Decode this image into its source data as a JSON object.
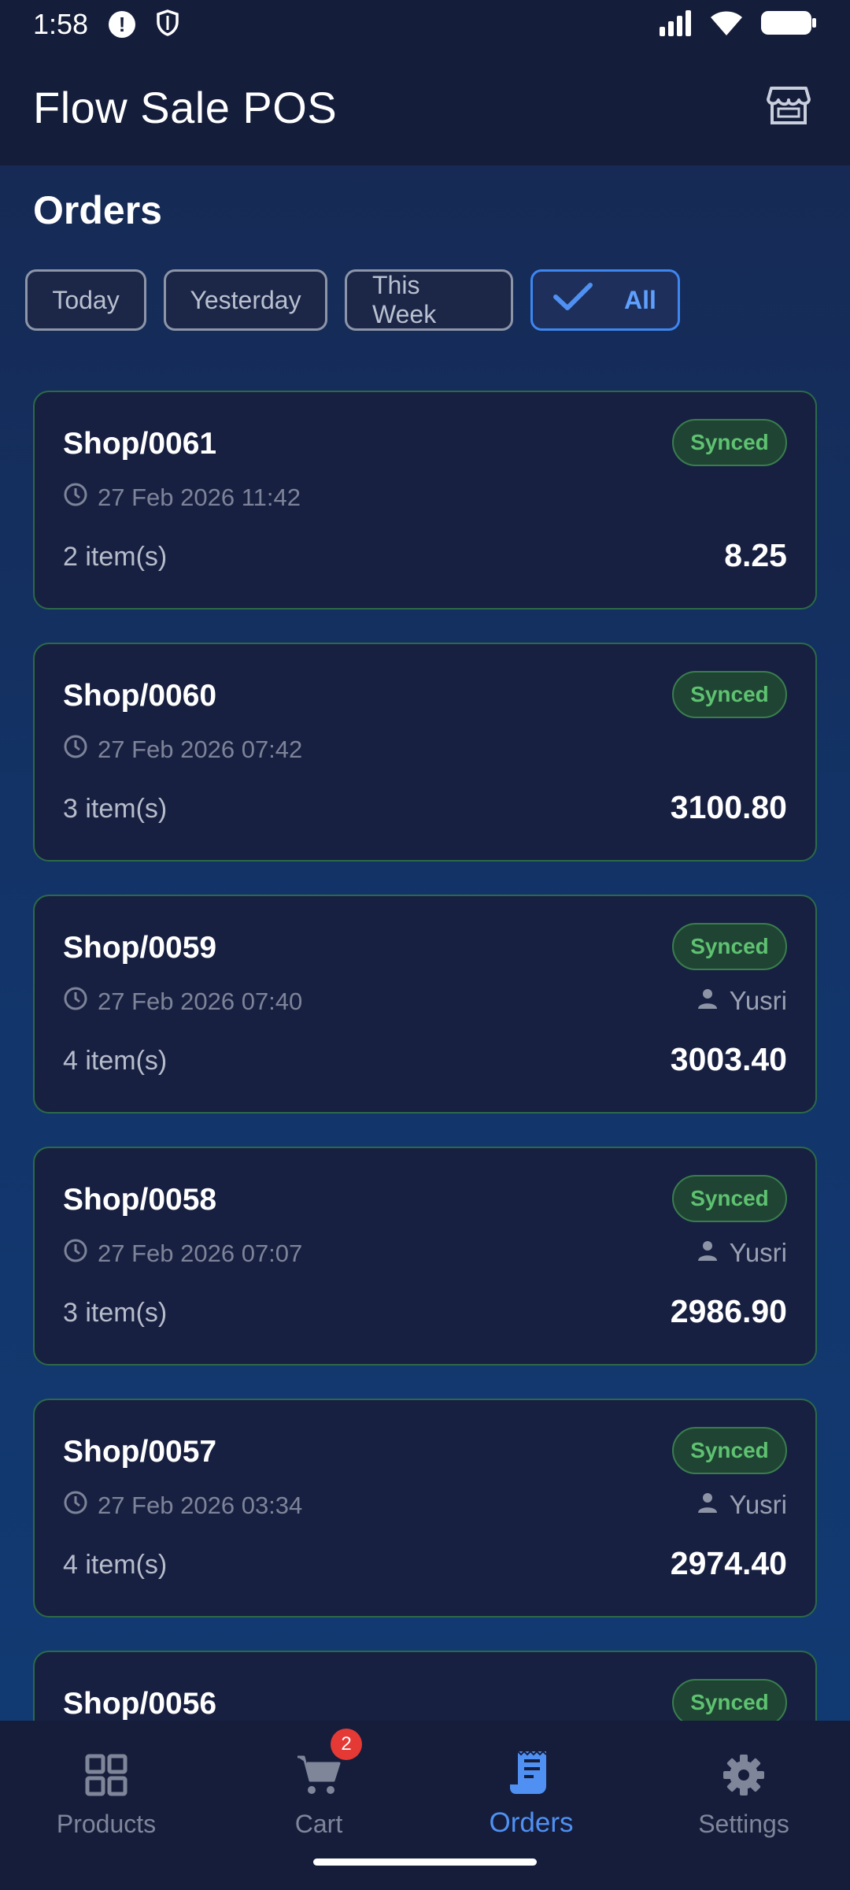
{
  "status_bar": {
    "time": "1:58"
  },
  "app_bar": {
    "title": "Flow Sale POS",
    "icon": "store-icon"
  },
  "page": {
    "title": "Orders"
  },
  "filters": [
    {
      "label": "Today",
      "selected": false
    },
    {
      "label": "Yesterday",
      "selected": false
    },
    {
      "label": "This Week",
      "selected": false
    },
    {
      "label": "All",
      "selected": true
    }
  ],
  "orders": [
    {
      "id": "Shop/0061",
      "status": "Synced",
      "date": "27 Feb 2026 11:42",
      "user": "",
      "items": "2 item(s)",
      "total": "8.25"
    },
    {
      "id": "Shop/0060",
      "status": "Synced",
      "date": "27 Feb 2026 07:42",
      "user": "",
      "items": "3 item(s)",
      "total": "3100.80"
    },
    {
      "id": "Shop/0059",
      "status": "Synced",
      "date": "27 Feb 2026 07:40",
      "user": "Yusri",
      "items": "4 item(s)",
      "total": "3003.40"
    },
    {
      "id": "Shop/0058",
      "status": "Synced",
      "date": "27 Feb 2026 07:07",
      "user": "Yusri",
      "items": "3 item(s)",
      "total": "2986.90"
    },
    {
      "id": "Shop/0057",
      "status": "Synced",
      "date": "27 Feb 2026 03:34",
      "user": "Yusri",
      "items": "4 item(s)",
      "total": "2974.40"
    },
    {
      "id": "Shop/0056",
      "status": "Synced",
      "date": "",
      "user": "",
      "items": "",
      "total": ""
    }
  ],
  "bottom_nav": [
    {
      "label": "Products",
      "icon": "grid-icon",
      "active": false
    },
    {
      "label": "Cart",
      "icon": "cart-icon",
      "active": false,
      "badge": "2"
    },
    {
      "label": "Orders",
      "icon": "receipt-icon",
      "active": true
    },
    {
      "label": "Settings",
      "icon": "gear-icon",
      "active": false
    }
  ],
  "colors": {
    "accent": "#4f90f2",
    "synced": "#5ec270",
    "badge": "#e53935"
  }
}
